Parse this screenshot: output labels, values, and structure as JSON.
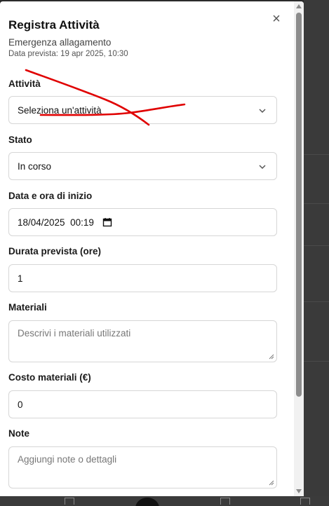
{
  "modal": {
    "title": "Registra Attività",
    "subtitle": "Emergenza allagamento",
    "date_line": "Data prevista: 19 apr 2025, 10:30",
    "close_symbol": "×"
  },
  "form": {
    "activity": {
      "label": "Attività",
      "value": "Seleziona un'attività"
    },
    "status": {
      "label": "Stato",
      "value": "In corso"
    },
    "start": {
      "label": "Data e ora di inizio",
      "value": "18/04/2025  00:19"
    },
    "duration": {
      "label": "Durata prevista (ore)",
      "value": "1"
    },
    "materials": {
      "label": "Materiali",
      "placeholder": "Descrivi i materiali utilizzati"
    },
    "materials_cost": {
      "label": "Costo materiali (€)",
      "value": "0"
    },
    "notes": {
      "label": "Note",
      "placeholder": "Aggiungi note o dettagli"
    }
  },
  "icons": {
    "close": "close-icon",
    "chevron": "chevron-down-icon",
    "calendar": "calendar-icon"
  },
  "colors": {
    "scribble": "#e00000",
    "field_border": "#d6d6d6",
    "backdrop": "#2b2b2b"
  }
}
